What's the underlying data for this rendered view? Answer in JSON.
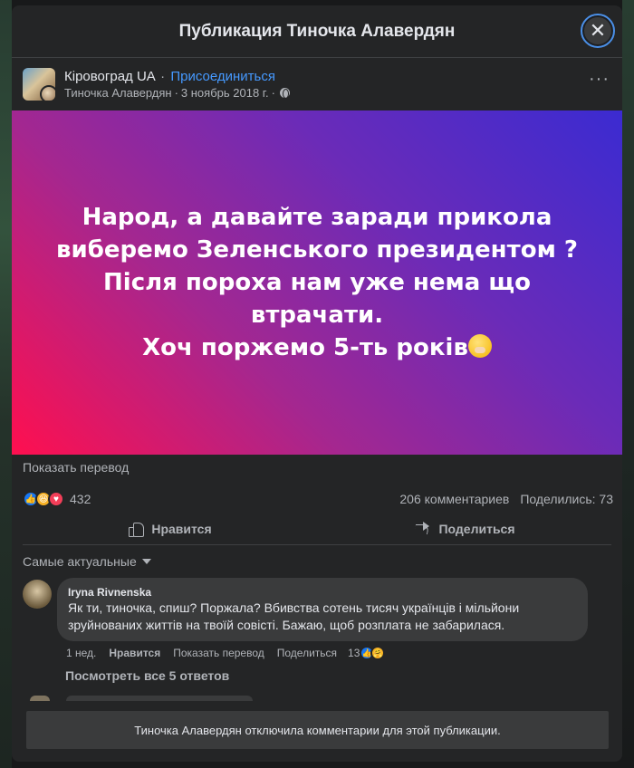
{
  "modal": {
    "title": "Публикация Тиночка Алавердян",
    "close_icon": "close-icon"
  },
  "post": {
    "group_name": "Кіровоград UA",
    "separator": "·",
    "join_label": "Присоединиться",
    "author": "Тиночка Алавердян",
    "date": "3 ноябрь 2018 г.",
    "date_separator": "·",
    "privacy_icon": "globe-icon",
    "more_icon": "more-horizontal-icon",
    "text_lines": [
      "Народ, а давайте заради прикола",
      "виберемо Зеленського президентом ?",
      "Після пороха нам уже нема що втрачати.",
      "Хоч поржемо 5-ть років"
    ],
    "text_emoji": "face-with-hand-over-mouth",
    "background_gradient": [
      "#3b2bd1",
      "#a42790",
      "#ff0f4f"
    ],
    "translate_label": "Показать перевод"
  },
  "stats": {
    "reaction_icons": [
      "like",
      "haha",
      "love"
    ],
    "reaction_count": "432",
    "comments": "206 комментариев",
    "shares": "Поделились: 73"
  },
  "actions": {
    "like_label": "Нравится",
    "share_label": "Поделиться"
  },
  "comments": {
    "sort_label": "Самые актуальные",
    "items": [
      {
        "author": "Iryna Rivnenska",
        "text": "Як ти, тиночка, спиш? Поржала? Вбивства сотень тисяч українців і мільйони зруйнованих життів на твоїй совісті. Бажаю, щоб розплата не забарилася.",
        "time": "1 нед.",
        "like_label": "Нравится",
        "translate_label": "Показать перевод",
        "share_label": "Поделиться",
        "reaction_count": "13",
        "reaction_icons": [
          "like",
          "care"
        ]
      }
    ],
    "view_replies": "Посмотреть все 5 ответов"
  },
  "footer": {
    "disabled_notice": "Тиночка Алавердян отключила комментарии для этой публикации."
  },
  "colors": {
    "surface": "#242526",
    "bubble": "#3a3b3c",
    "link": "#4599ff",
    "text_secondary": "#b0b3b8"
  }
}
